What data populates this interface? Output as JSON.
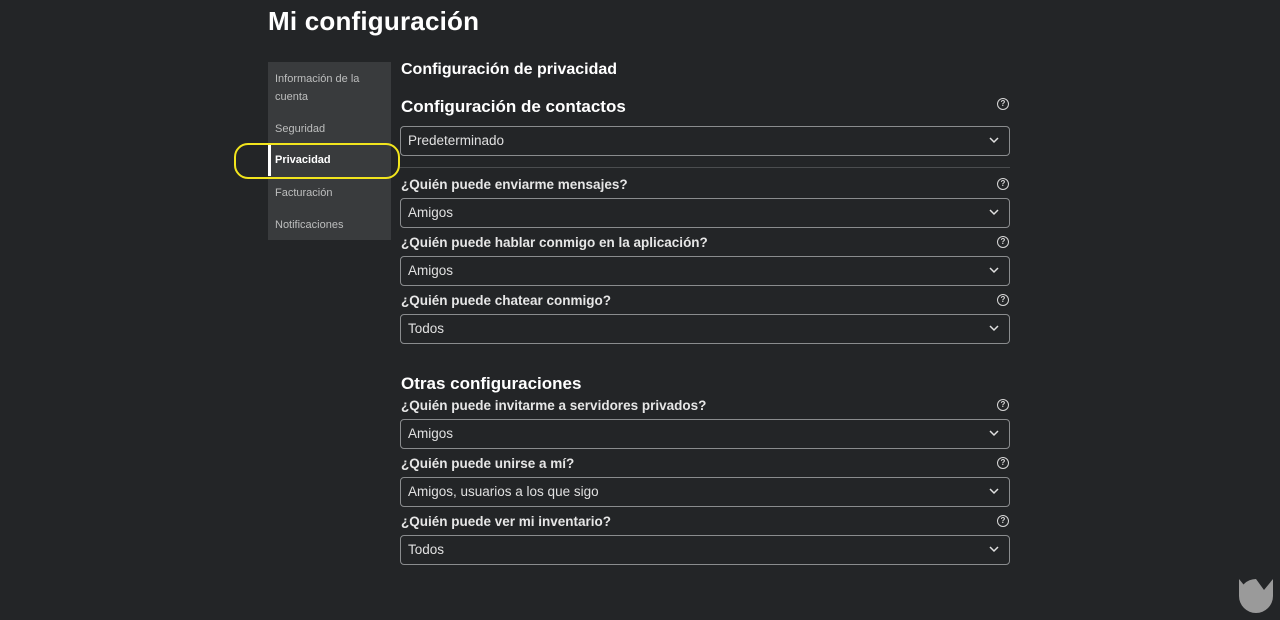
{
  "page_title": "Mi configuración",
  "sidebar": {
    "items": [
      {
        "label": "Información de la cuenta",
        "active": false
      },
      {
        "label": "Seguridad",
        "active": false
      },
      {
        "label": "Privacidad",
        "active": true
      },
      {
        "label": "Facturación",
        "active": false
      },
      {
        "label": "Notificaciones",
        "active": false
      }
    ]
  },
  "main": {
    "section_title": "Configuración de privacidad",
    "contacts_title": "Configuración de contactos",
    "contacts_value": "Predeterminado",
    "questions": [
      {
        "label": "¿Quién puede enviarme mensajes?",
        "value": "Amigos"
      },
      {
        "label": "¿Quién puede hablar conmigo en la aplicación?",
        "value": "Amigos"
      },
      {
        "label": "¿Quién puede chatear conmigo?",
        "value": "Todos"
      }
    ],
    "other_title": "Otras configuraciones",
    "other_questions": [
      {
        "label": "¿Quién puede invitarme a servidores privados?",
        "value": "Amigos"
      },
      {
        "label": "¿Quién puede unirse a mí?",
        "value": "Amigos, usuarios a los que sigo"
      },
      {
        "label": "¿Quién puede ver mi inventario?",
        "value": "Todos"
      }
    ],
    "help_glyph": "?"
  },
  "colors": {
    "background": "#232527",
    "sidebar_bg": "#393b3d",
    "highlight": "#f2e51d",
    "border": "#8a8c8e"
  }
}
